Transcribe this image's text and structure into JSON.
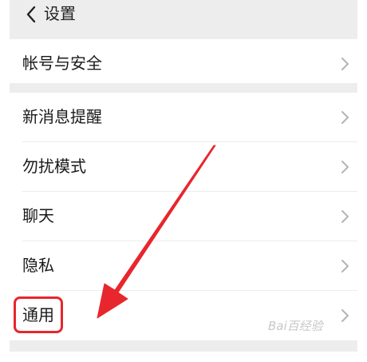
{
  "navbar": {
    "back_icon": "chevron-left-icon",
    "title": "设置"
  },
  "groups": [
    {
      "items": [
        {
          "label": "帐号与安全",
          "icon": "chevron-right-icon"
        }
      ]
    },
    {
      "items": [
        {
          "label": "新消息提醒",
          "icon": "chevron-right-icon"
        },
        {
          "label": "勿扰模式",
          "icon": "chevron-right-icon"
        },
        {
          "label": "聊天",
          "icon": "chevron-right-icon"
        },
        {
          "label": "隐私",
          "icon": "chevron-right-icon"
        },
        {
          "label": "通用",
          "icon": "chevron-right-icon"
        }
      ]
    }
  ],
  "annotation": {
    "highlight_color": "#e8262d",
    "arrow_color": "#e8262d",
    "highlighted_item": "通用"
  },
  "watermark": {
    "text": "Bai百经验"
  },
  "colors": {
    "background": "#ffffff",
    "section_gap": "#ededed",
    "text": "#1a1a1a",
    "chevron": "#b4b4b4"
  }
}
